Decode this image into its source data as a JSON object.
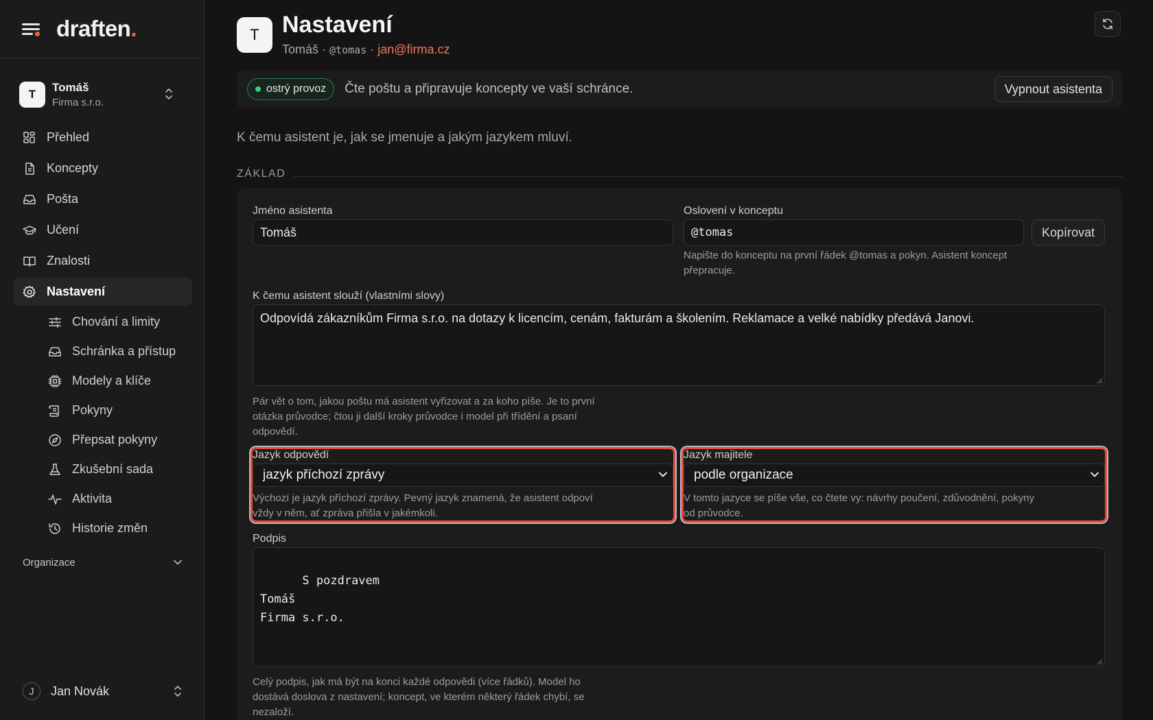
{
  "brand": {
    "name": "draften",
    "dot": "."
  },
  "account": {
    "initial": "T",
    "name": "Tomáš",
    "org": "Firma s.r.o."
  },
  "nav": {
    "items": [
      {
        "label": "Přehled",
        "icon": "grid-icon"
      },
      {
        "label": "Koncepty",
        "icon": "document-icon"
      },
      {
        "label": "Pošta",
        "icon": "inbox-icon"
      },
      {
        "label": "Učení",
        "icon": "graduation-cap-icon"
      },
      {
        "label": "Znalosti",
        "icon": "book-icon"
      },
      {
        "label": "Nastavení",
        "icon": "gear-icon",
        "active": true
      }
    ],
    "subitems": [
      {
        "label": "Chování a limity",
        "icon": "sliders-icon"
      },
      {
        "label": "Schránka a přístup",
        "icon": "inbox-icon"
      },
      {
        "label": "Modely a klíče",
        "icon": "chip-icon"
      },
      {
        "label": "Pokyny",
        "icon": "scroll-icon"
      },
      {
        "label": "Přepsat pokyny",
        "icon": "compass-icon"
      },
      {
        "label": "Zkušební sada",
        "icon": "flask-icon"
      },
      {
        "label": "Aktivita",
        "icon": "activity-icon"
      },
      {
        "label": "Historie změn",
        "icon": "history-icon"
      }
    ]
  },
  "org_section": {
    "label": "Organizace"
  },
  "user": {
    "initial": "J",
    "name": "Jan Novák"
  },
  "header": {
    "initial": "T",
    "title": "Nastavení",
    "name": "Tomáš",
    "sep": "·",
    "handle": "@tomas",
    "email": "jan@firma.cz"
  },
  "status": {
    "badge": "ostrý provoz",
    "text": "Čte poštu a připravuje koncepty ve vaší schránce.",
    "off_button": "Vypnout asistenta"
  },
  "intro": "K čemu asistent je, jak se jmenuje a jakým jazykem mluví.",
  "section": "ZÁKLAD",
  "form": {
    "name_label": "Jméno asistenta",
    "name_value": "Tomáš",
    "greeting_label": "Oslovení v konceptu",
    "greeting_value": "@tomas",
    "copy_button": "Kopírovat",
    "greeting_help": "Napište do konceptu na první řádek @tomas a pokyn. Asistent koncept přepracuje.",
    "purpose_label": "K čemu asistent slouží (vlastními slovy)",
    "purpose_value": "Odpovídá zákazníkům Firma s.r.o. na dotazy k licencím, cenám, fakturám a školením. Reklamace a velké nabídky předává Janovi.",
    "purpose_help": "Pár vět o tom, jakou poštu má asistent vyřizovat a za koho píše. Je to první otázka průvodce; čtou ji další kroky průvodce i model při třídění a psaní odpovědí.",
    "reply_lang_label": "Jazyk odpovědí",
    "reply_lang_value": "jazyk příchozí zprávy",
    "reply_lang_help": "Výchozí je jazyk příchozí zprávy. Pevný jazyk znamená, že asistent odpoví vždy v něm, ať zpráva přišla v jakémkoli.",
    "owner_lang_label": "Jazyk majitele",
    "owner_lang_value": "podle organizace",
    "owner_lang_help": "V tomto jazyce se píše vše, co čtete vy: návrhy poučení, zdůvodnění, pokyny od průvodce.",
    "signature_label": "Podpis",
    "signature_value": "S pozdravem\nTomáš\nFirma s.r.o.",
    "signature_help": "Celý podpis, jak má být na konci každé odpovědi (více řádků). Model ho dostává doslova z nastavení; koncept, ve kterém některý řádek chybí, se nezaloží."
  },
  "colors": {
    "accent": "#f0624a",
    "email": "#f0785f",
    "live": "#3fcf7f",
    "highlight": "#e34a3f"
  }
}
